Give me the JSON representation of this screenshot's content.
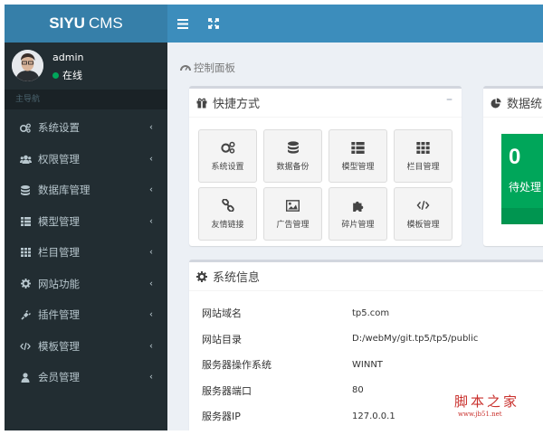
{
  "brand": {
    "bold": "SIYU",
    "rest": "CMS"
  },
  "topbar": {
    "menu_toggle_icon": "bars-icon",
    "fullscreen_icon": "expand-icon"
  },
  "user": {
    "name": "admin",
    "status": "在线"
  },
  "sidebar": {
    "header": "主导航",
    "items": [
      {
        "label": "系统设置",
        "icon": "cogs-icon"
      },
      {
        "label": "权限管理",
        "icon": "users-icon"
      },
      {
        "label": "数据库管理",
        "icon": "database-icon"
      },
      {
        "label": "模型管理",
        "icon": "list-icon"
      },
      {
        "label": "栏目管理",
        "icon": "grid-icon"
      },
      {
        "label": "网站功能",
        "icon": "gear-icon"
      },
      {
        "label": "插件管理",
        "icon": "plug-icon"
      },
      {
        "label": "模板管理",
        "icon": "code-icon"
      },
      {
        "label": "会员管理",
        "icon": "user-icon"
      }
    ]
  },
  "breadcrumb": {
    "label": "控制面板"
  },
  "shortcuts": {
    "title": "快捷方式",
    "collapse": "–",
    "tiles": [
      {
        "label": "系统设置",
        "icon": "cogs-icon"
      },
      {
        "label": "数据备份",
        "icon": "database-icon"
      },
      {
        "label": "模型管理",
        "icon": "list-icon"
      },
      {
        "label": "栏目管理",
        "icon": "grid-icon"
      },
      {
        "label": "友情链接",
        "icon": "link-icon"
      },
      {
        "label": "广告管理",
        "icon": "image-icon"
      },
      {
        "label": "碎片管理",
        "icon": "puzzle-icon"
      },
      {
        "label": "模板管理",
        "icon": "code-icon"
      }
    ]
  },
  "stats": {
    "title": "数据统",
    "pending_count": "0",
    "pending_label": "待处理",
    "color": "#00a65a"
  },
  "sysinfo": {
    "title": "系统信息",
    "rows": [
      {
        "key": "网站域名",
        "value": "tp5.com"
      },
      {
        "key": "网站目录",
        "value": "D:/webMy/git.tp5/tp5/public"
      },
      {
        "key": "服务器操作系统",
        "value": "WINNT"
      },
      {
        "key": "服务器端口",
        "value": "80"
      },
      {
        "key": "服务器IP",
        "value": "127.0.0.1"
      }
    ]
  },
  "watermark": {
    "main": "脚本之家",
    "url": "www.jb51.net"
  },
  "colors": {
    "logo_bg": "#367fa9",
    "topbar_bg": "#3c8dbc",
    "sidebar_bg": "#222d32",
    "content_bg": "#ecf0f5"
  }
}
